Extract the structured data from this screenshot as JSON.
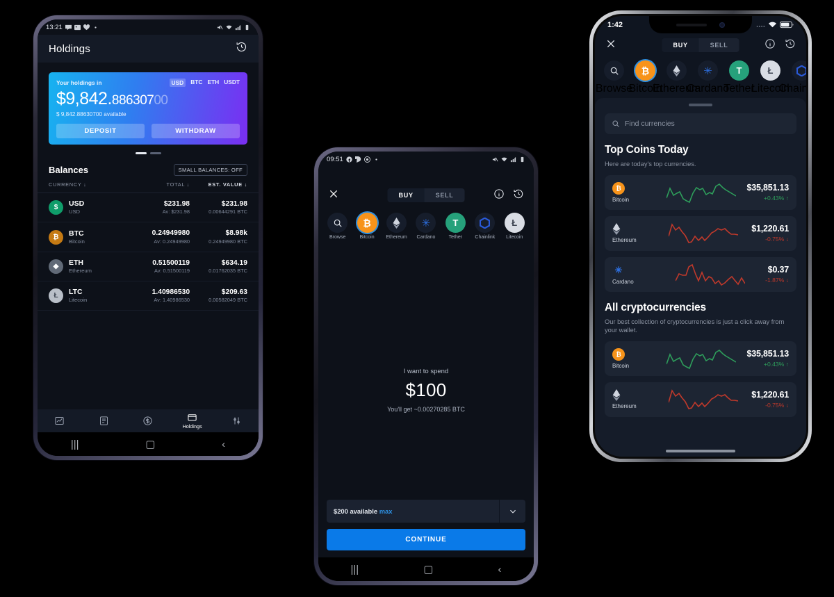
{
  "phone1": {
    "device": "android",
    "status_bar": {
      "time": "13:21",
      "icons": [
        "message-icon",
        "image-icon",
        "heart-icon",
        "dot-icon"
      ],
      "right_icons": [
        "mute-icon",
        "wifi-icon",
        "signal-icon",
        "battery-icon"
      ]
    },
    "appbar": {
      "title": "Holdings",
      "history_icon": "history-icon"
    },
    "holding_card": {
      "label": "Your holdings in",
      "currencies": [
        "USD",
        "BTC",
        "ETH",
        "USDT"
      ],
      "selected_currency": "USD",
      "amount_whole": "$9,842.",
      "amount_dec": "886307",
      "amount_faded": "00",
      "available": "$ 9,842.88630700  available",
      "deposit_label": "DEPOSIT",
      "withdraw_label": "WITHDRAW",
      "gradient_from": "#17b3f0",
      "gradient_to": "#7a2ef2"
    },
    "pager": {
      "count": 2,
      "active": 0
    },
    "balances": {
      "title": "Balances",
      "small_balances_label": "SMALL BALANCES: OFF",
      "columns": [
        "CURRENCY ↓",
        "TOTAL ↓",
        "EST. VALUE ↓"
      ],
      "rows": [
        {
          "symbol": "USD",
          "name": "USD",
          "total": "$231.98",
          "avg": "Av: $231.98",
          "est_value": "$231.98",
          "est_btc": "0.00644291 BTC",
          "icon_bg": "#0f9d6a",
          "icon_glyph": "$"
        },
        {
          "symbol": "BTC",
          "name": "Bitcoin",
          "total": "0.24949980",
          "avg": "Av: 0.24949980",
          "est_value": "$8.98k",
          "est_btc": "0.24949980 BTC",
          "icon_bg": "#c57a13",
          "icon_glyph": "₿"
        },
        {
          "symbol": "ETH",
          "name": "Ethereum",
          "total": "0.51500119",
          "avg": "Av: 0.51500119",
          "est_value": "$634.19",
          "est_btc": "0.01762035 BTC",
          "icon_bg": "#616a77",
          "icon_glyph": "◆"
        },
        {
          "symbol": "LTC",
          "name": "Litecoin",
          "total": "1.40986530",
          "avg": "Av: 1.40986530",
          "est_value": "$209.63",
          "est_btc": "0.00582049 BTC",
          "icon_bg": "#b9bfc8",
          "icon_glyph": "Ł"
        }
      ]
    },
    "tabbar": {
      "items": [
        {
          "name": "chart-icon",
          "label": ""
        },
        {
          "name": "list-icon",
          "label": ""
        },
        {
          "name": "dollar-icon",
          "label": ""
        },
        {
          "name": "wallet-icon",
          "label": "Holdings"
        },
        {
          "name": "sliders-icon",
          "label": ""
        }
      ],
      "active_index": 3
    },
    "nav": [
      "recents-icon",
      "home-icon",
      "back-icon"
    ]
  },
  "phone2": {
    "device": "android",
    "status_bar": {
      "time": "09:51",
      "icons": [
        "facebook-icon",
        "chat-icon",
        "at-icon",
        "dot-icon"
      ],
      "right_icons": [
        "mute-icon",
        "wifi-icon",
        "signal-icon",
        "battery-icon"
      ]
    },
    "header": {
      "close_icon": "close-icon",
      "segments": [
        "BUY",
        "SELL"
      ],
      "active_segment": "BUY",
      "info_icon": "info-icon",
      "history_icon": "history-icon"
    },
    "coins": [
      {
        "label": "Browse",
        "icon": "search-icon",
        "bg": "#161d2b",
        "fg": "#e4e8ef",
        "glyph": ""
      },
      {
        "label": "Bitcoin",
        "icon": "bitcoin-icon",
        "bg": "#f7931a",
        "fg": "#ffffff",
        "glyph": "₿",
        "selected": true
      },
      {
        "label": "Ethereum",
        "icon": "ethereum-icon",
        "bg": "#161d2b",
        "fg": "#cfd4de",
        "glyph": "◆"
      },
      {
        "label": "Cardano",
        "icon": "cardano-icon",
        "bg": "#161d2b",
        "fg": "#2d6fe0",
        "glyph": "✳"
      },
      {
        "label": "Tether",
        "icon": "tether-icon",
        "bg": "#26a17b",
        "fg": "#ffffff",
        "glyph": "T"
      },
      {
        "label": "Chainlink",
        "icon": "chainlink-icon",
        "bg": "#161d2b",
        "fg": "#2a5ada",
        "glyph": "⬡"
      },
      {
        "label": "Litecoin",
        "icon": "litecoin-icon",
        "bg": "#d9dde4",
        "fg": "#3c4350",
        "glyph": "Ł"
      }
    ],
    "spend": {
      "prompt": "I want to spend",
      "amount": "$100",
      "receive": "You'll get ~0.00270285 BTC"
    },
    "footer": {
      "available_text": "$200 available",
      "max_label": "max",
      "chevron_icon": "chevron-down-icon",
      "continue_label": "CONTINUE",
      "continue_color": "#0a7ae8"
    },
    "nav": [
      "recents-icon",
      "home-icon",
      "back-icon"
    ]
  },
  "phone3": {
    "device": "ios",
    "status_bar": {
      "time": "1:42",
      "right_icons": [
        "cellular-icon",
        "wifi-icon",
        "battery-icon"
      ]
    },
    "header": {
      "close_icon": "close-icon",
      "segments": [
        "BUY",
        "SELL"
      ],
      "active_segment": "BUY",
      "info_icon": "info-icon",
      "history_icon": "history-icon"
    },
    "coins": [
      {
        "label": "Browse",
        "icon": "search-icon",
        "bg": "#161d2b",
        "fg": "#e4e8ef",
        "glyph": ""
      },
      {
        "label": "Bitcoin",
        "icon": "bitcoin-icon",
        "bg": "#f7931a",
        "fg": "#ffffff",
        "glyph": "₿",
        "selected": true
      },
      {
        "label": "Ethereum",
        "icon": "ethereum-icon",
        "bg": "#161d2b",
        "fg": "#cfd4de",
        "glyph": "◆"
      },
      {
        "label": "Cardano",
        "icon": "cardano-icon",
        "bg": "#161d2b",
        "fg": "#2d6fe0",
        "glyph": "✳"
      },
      {
        "label": "Tether",
        "icon": "tether-icon",
        "bg": "#26a17b",
        "fg": "#ffffff",
        "glyph": "T"
      },
      {
        "label": "Litecoin",
        "icon": "litecoin-icon",
        "bg": "#d9dde4",
        "fg": "#3c4350",
        "glyph": "Ł"
      },
      {
        "label": "Chainlink",
        "icon": "chainlink-icon",
        "bg": "#161d2b",
        "fg": "#2a5ada",
        "glyph": "⬡"
      }
    ],
    "search": {
      "placeholder": "Find currencies",
      "icon": "search-icon"
    },
    "sections": [
      {
        "title": "Top Coins Today",
        "subtitle": "Here are today's top currencies.",
        "cards": [
          {
            "name": "Bitcoin",
            "price": "$35,851.13",
            "change": "+0.43% ↑",
            "trend": "up",
            "icon_bg": "#f7931a",
            "glyph": "₿",
            "spark": [
              30,
              14,
              26,
              22,
              20,
              34,
              38,
              40,
              22,
              12,
              16,
              14,
              26,
              22,
              24,
              10,
              6,
              12,
              16,
              20,
              24,
              28
            ]
          },
          {
            "name": "Ethereum",
            "price": "$1,220.61",
            "change": "-0.75% ↓",
            "trend": "down",
            "icon_bg": "#20242d",
            "glyph": "◆",
            "spark": [
              20,
              4,
              12,
              8,
              14,
              20,
              34,
              36,
              24,
              30,
              26,
              34,
              30,
              22,
              18,
              14,
              16,
              12,
              18,
              22,
              20,
              24
            ]
          },
          {
            "name": "Cardano",
            "price": "$0.37",
            "change": "-1.87% ↓",
            "trend": "down",
            "icon_bg": "#18233d",
            "glyph": "✳",
            "spark": [
              26,
              16,
              18,
              18,
              6,
              2,
              16,
              26,
              14,
              26,
              20,
              22,
              30,
              26,
              34,
              30,
              24,
              20,
              26,
              32,
              22,
              30
            ]
          }
        ]
      },
      {
        "title": "All cryptocurrencies",
        "subtitle": "Our best collection of cryptocurrencies is just a click away from your wallet.",
        "cards": [
          {
            "name": "Bitcoin",
            "price": "$35,851.13",
            "change": "+0.43% ↑",
            "trend": "up",
            "icon_bg": "#f7931a",
            "glyph": "₿",
            "spark": [
              30,
              14,
              26,
              22,
              20,
              34,
              38,
              40,
              22,
              12,
              16,
              14,
              26,
              22,
              24,
              10,
              6,
              12,
              16,
              20,
              24,
              28
            ]
          },
          {
            "name": "Ethereum",
            "price": "$1,220.61",
            "change": "-0.75% ↓",
            "trend": "down",
            "icon_bg": "#20242d",
            "glyph": "◆",
            "spark": [
              20,
              4,
              12,
              8,
              14,
              20,
              34,
              36,
              24,
              30,
              26,
              34,
              30,
              22,
              18,
              14,
              16,
              12,
              18,
              22,
              20,
              24
            ]
          }
        ]
      }
    ],
    "colors": {
      "up": "#2e9e5b",
      "down": "#c0392b"
    }
  }
}
